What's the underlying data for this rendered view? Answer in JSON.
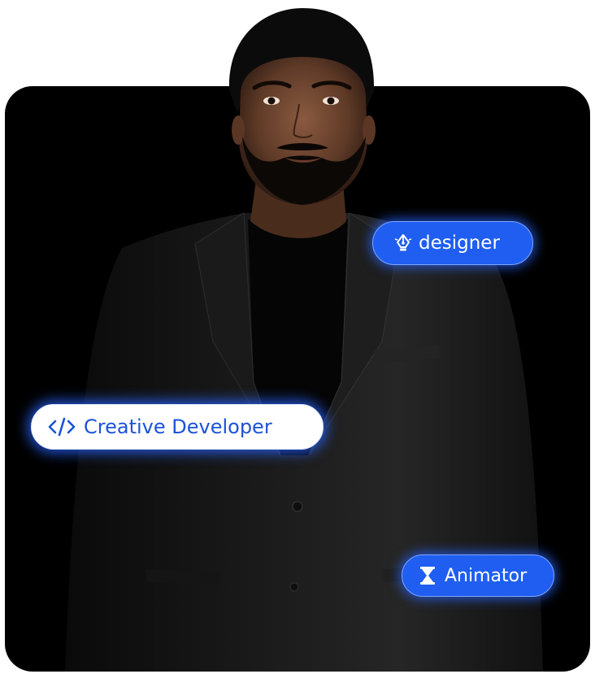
{
  "portrait": {
    "image": "portrait-photo"
  },
  "chips": {
    "designer": {
      "label": "designer",
      "icon": "pen-nib-icon"
    },
    "creative_developer": {
      "label": "Creative Developer",
      "icon": "code-icon"
    },
    "animator": {
      "label": "Animator",
      "icon": "hourglass-icon"
    }
  },
  "colors": {
    "card_bg": "#000000",
    "chip_blue": "#1f5ef0",
    "chip_white_text": "#1b53d8",
    "glow": "#2864ff"
  }
}
